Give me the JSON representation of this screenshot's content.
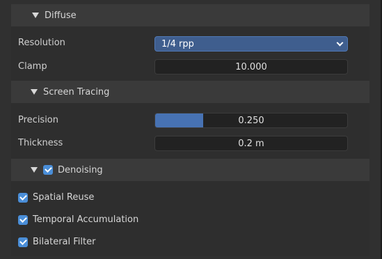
{
  "sections": {
    "diffuse": {
      "title": "Diffuse",
      "resolution_label": "Resolution",
      "resolution_value": "1/4 rpp",
      "clamp_label": "Clamp",
      "clamp_value": "10.000"
    },
    "screen_tracing": {
      "title": "Screen Tracing",
      "precision_label": "Precision",
      "precision_value": "0.250",
      "precision_fraction": 0.25,
      "thickness_label": "Thickness",
      "thickness_value": "0.2 m"
    },
    "denoising": {
      "title": "Denoising",
      "enabled": true,
      "options": [
        {
          "label": "Spatial Reuse",
          "checked": true
        },
        {
          "label": "Temporal Accumulation",
          "checked": true
        },
        {
          "label": "Bilateral Filter",
          "checked": true
        }
      ]
    }
  },
  "colors": {
    "accent": "#4772b3",
    "checkbox": "#4a8ed8",
    "panel_bg": "#303030",
    "header_bg": "#3a3a3a",
    "field_bg": "#222222"
  },
  "icons": {
    "expand": "triangle-down-icon",
    "checkbox": "checkbox-checked-icon",
    "dropdown": "chevron-down-icon"
  }
}
